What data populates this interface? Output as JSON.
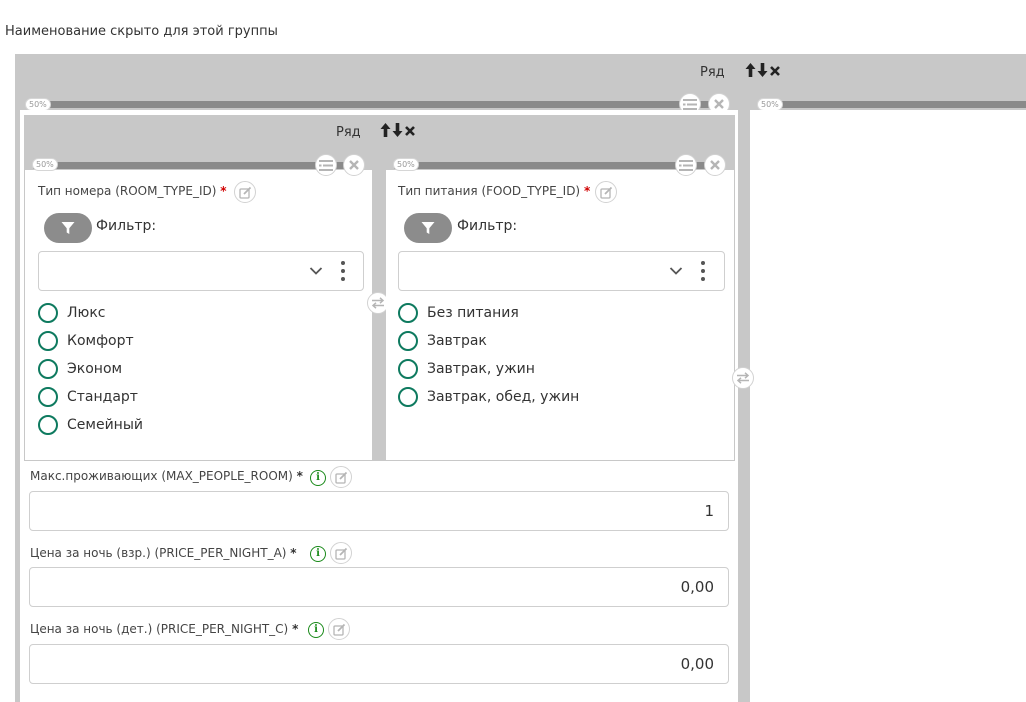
{
  "group": {
    "title": "Наименование скрыто для этой группы"
  },
  "outer_row": {
    "label": "Ряд",
    "icons": "move-up-down-delete"
  },
  "left_col": {
    "width_badge": "50%"
  },
  "right_col": {
    "width_badge": "50%"
  },
  "inner_row": {
    "label": "Ряд"
  },
  "room_col": {
    "width_badge": "50%",
    "field_label": "Тип номера (ROOM_TYPE_ID)",
    "required_mark": "*",
    "filter_label": "Фильтр:",
    "options": [
      "Люкс",
      "Комфорт",
      "Эконом",
      "Стандарт",
      "Семейный"
    ]
  },
  "food_col": {
    "width_badge": "50%",
    "field_label": "Тип питания (FOOD_TYPE_ID)",
    "required_mark": "*",
    "filter_label": "Фильтр:",
    "options": [
      "Без питания",
      "Завтрак",
      "Завтрак, ужин",
      "Завтрак, обед, ужин"
    ]
  },
  "fields": [
    {
      "label": "Макс.проживающих (MAX_PEOPLE_ROOM)",
      "required_mark": "*",
      "value": "1"
    },
    {
      "label": "Цена за ночь (взр.) (PRICE_PER_NIGHT_A)",
      "required_mark": "*",
      "value": "0,00"
    },
    {
      "label": "Цена за ночь (дет.) (PRICE_PER_NIGHT_C)",
      "required_mark": "*",
      "value": "0,00"
    }
  ],
  "colors": {
    "radio_border": "#0e7a5f",
    "required": "#d00000",
    "info": "#1a8a1a",
    "frame": "#c8c8c8"
  }
}
